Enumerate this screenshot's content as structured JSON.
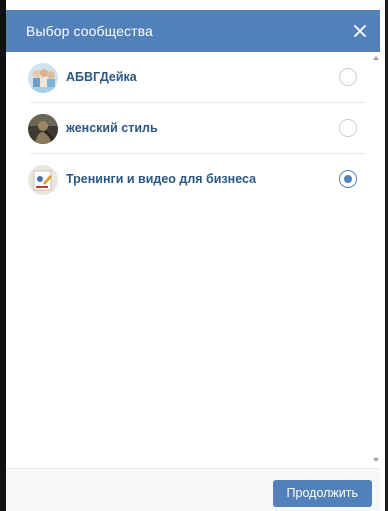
{
  "dialog": {
    "title": "Выбор сообщества",
    "close_icon": "close-icon"
  },
  "communities": [
    {
      "name": "АБВГДейка",
      "selected": false,
      "avatar": "group-photo-avatar"
    },
    {
      "name": "женский стиль",
      "selected": false,
      "avatar": "portrait-avatar"
    },
    {
      "name": "Тренинги и видео для бизнеса",
      "selected": true,
      "avatar": "business-avatar"
    }
  ],
  "footer": {
    "continue_label": "Продолжить"
  },
  "colors": {
    "accent": "#5181b8",
    "link": "#2a5885",
    "footer_bg": "#f7f8fa",
    "separator": "#e7e8ec"
  }
}
